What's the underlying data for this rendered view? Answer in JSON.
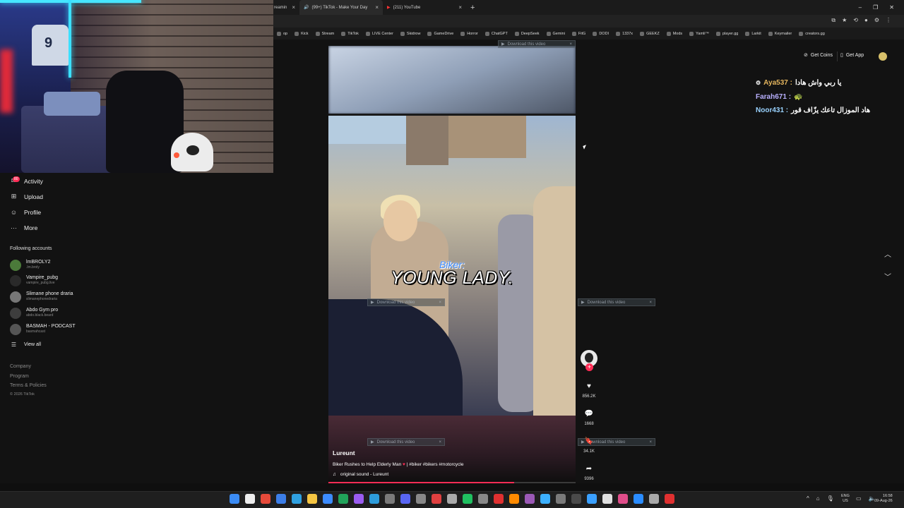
{
  "browser": {
    "tabs": [
      {
        "label": "reamin",
        "icon": "stream-icon"
      },
      {
        "label": "(99+) TikTok - Make Your Day",
        "icon": "tiktok-icon"
      },
      {
        "label": "(211) YouTube",
        "icon": "youtube-icon"
      }
    ],
    "new_tab": "+",
    "bookmarks": [
      "op",
      "Kick",
      "Stream",
      "TikTok",
      "LIVE Center",
      "Skidrow",
      "GameDrive",
      "Horror",
      "ChatGPT",
      "DeepSeek",
      "Gemini",
      "FitG",
      "DODI",
      "1337x",
      "GEEKZ",
      "Mods",
      "Yamli™",
      "player.gg",
      "Larkit",
      "Keymailer",
      "creators.gg"
    ]
  },
  "sidebar": {
    "items": [
      {
        "label": "Activity",
        "icon": "activity-icon",
        "badge": "80"
      },
      {
        "label": "Upload",
        "icon": "upload-icon"
      },
      {
        "label": "Profile",
        "icon": "profile-icon"
      },
      {
        "label": "More",
        "icon": "more-icon"
      }
    ],
    "following_header": "Following accounts",
    "accounts": [
      {
        "name": "lmBROLY2",
        "handle": ".lm.broly"
      },
      {
        "name": "Vampire_pubg",
        "handle": "vampire_pubg.live"
      },
      {
        "name": "Slimane phone draria",
        "handle": "slimanephonedraria"
      },
      {
        "name": "Abdo Gym pro",
        "handle": "abdo.black.beard"
      },
      {
        "name": "BASMAH - PODCAST",
        "handle": "basmahcast"
      }
    ],
    "view_all": "View all",
    "footer": [
      "Company",
      "Program",
      "Terms & Policies"
    ],
    "copyright": "© 2026 TikTok"
  },
  "video": {
    "caption_speaker": "Biker:",
    "caption_text": "YOUNG LADY.",
    "author": "Lureunt",
    "description": "Biker Rushes to Help Elderly Man",
    "hashtags": "| #biker #bikers #motorcycle",
    "sound": "original sound - Lureunt",
    "progress": 0.75,
    "download_label": "Download this video",
    "download_close": "×"
  },
  "actions": {
    "likes": "856.2K",
    "comments": "1668",
    "saves": "34.1K",
    "shares": "9396"
  },
  "topbar": {
    "coins": "Get Coins",
    "app": "Get App"
  },
  "chat": [
    {
      "user": "Aya537 :",
      "text": "يا ربي واش هادا"
    },
    {
      "user": "Farah671 :",
      "text": "🐢"
    },
    {
      "user": "Noor431 :",
      "text": "هاد الموزال تاعك يزّاف قور"
    }
  ],
  "taskbar": {
    "lang_top": "ENG",
    "lang_bottom": "US",
    "time": "16:58",
    "date": "09-Aug-26"
  },
  "colors": {
    "accent": "#fe2c55",
    "bg": "#121212"
  }
}
